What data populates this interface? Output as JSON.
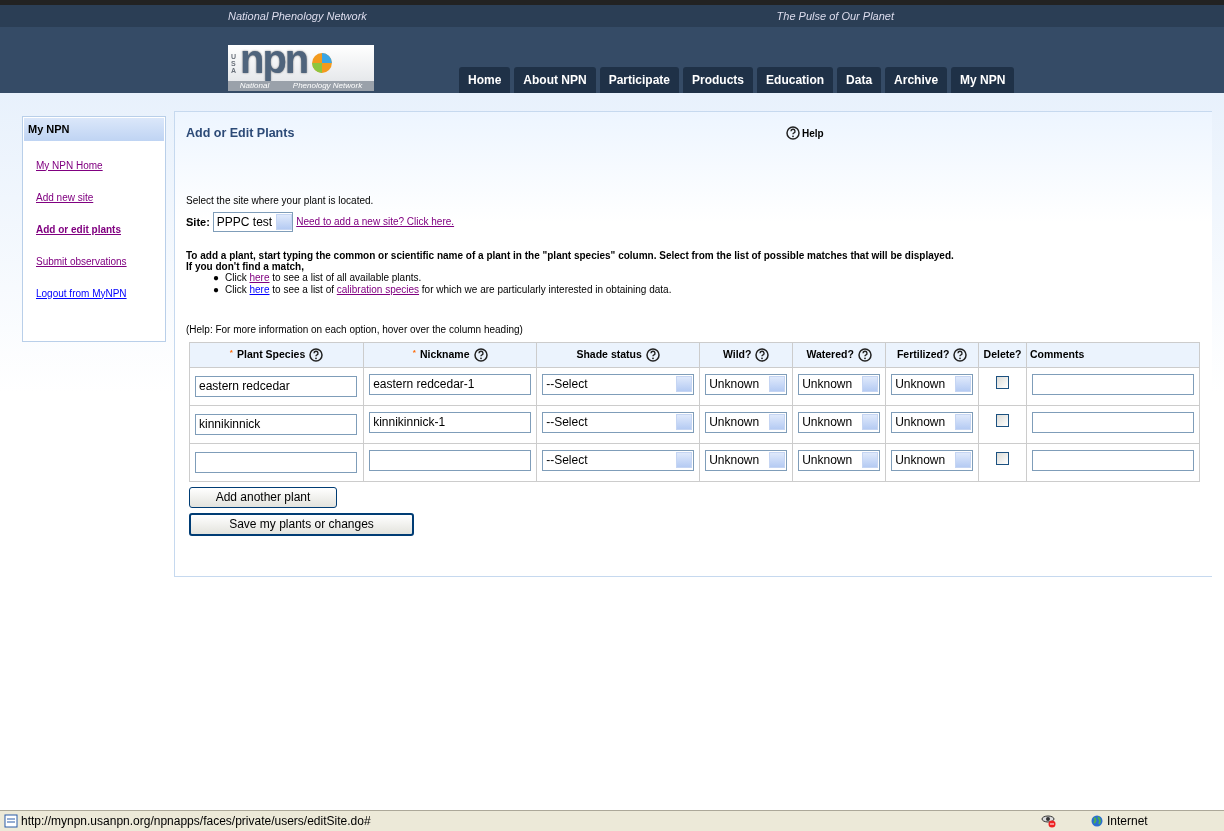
{
  "header": {
    "left_tagline": "National Phenology Network",
    "right_tagline": "The Pulse of Our Planet",
    "logo": {
      "country": "USA",
      "wordmark": "npn",
      "subtitle_1": "National",
      "subtitle_2": "Phenology Network"
    },
    "nav": [
      {
        "label": "Home"
      },
      {
        "label": "About NPN"
      },
      {
        "label": "Participate"
      },
      {
        "label": "Products"
      },
      {
        "label": "Education"
      },
      {
        "label": "Data"
      },
      {
        "label": "Archive"
      },
      {
        "label": "My NPN"
      }
    ]
  },
  "sidebar": {
    "title": "My NPN",
    "items": [
      {
        "label": "My NPN Home",
        "selected": false,
        "visited": true
      },
      {
        "label": "Add new site",
        "selected": false,
        "visited": true
      },
      {
        "label": "Add or edit plants",
        "selected": true,
        "visited": true
      },
      {
        "label": "Submit observations",
        "selected": false,
        "visited": true
      },
      {
        "label": "Logout from MyNPN",
        "selected": false,
        "visited": false
      }
    ]
  },
  "main": {
    "title": "Add or Edit Plants",
    "help": "Help",
    "site_prompt": "Select the site where your plant is located.",
    "site_label": "Site:",
    "site_value": "PPPC test",
    "site_link": "Need to add a new site? Click here.",
    "instructions": [
      "To add a plant, start typing the common or scientific name of a plant in the \"plant species\" column. Select from the list of possible matches that will be displayed.",
      "If you don't find a match,"
    ],
    "bullet_marker": "●",
    "bullets": [
      [
        {
          "kind": "text",
          "text": "Click "
        },
        {
          "kind": "link",
          "text": "here",
          "visited": true
        },
        {
          "kind": "text",
          "text": " to see a list of all available plants."
        }
      ],
      [
        {
          "kind": "text",
          "text": "Click "
        },
        {
          "kind": "link",
          "text": "here",
          "visited": false
        },
        {
          "kind": "text",
          "text": " to see a list of "
        },
        {
          "kind": "link",
          "text": "calibration species",
          "visited": true
        },
        {
          "kind": "text",
          "text": " for which we are particularly interested in obtaining data."
        }
      ]
    ],
    "table_help": "(Help: For more information on each option, hover over the column heading)",
    "table": {
      "columns": [
        {
          "label": "Plant Species",
          "required_marker": "*",
          "help": true
        },
        {
          "label": "Nickname",
          "required_marker": "*",
          "help": true
        },
        {
          "label": "Shade status",
          "help": true
        },
        {
          "label": "Wild?",
          "help": true
        },
        {
          "label": "Watered?",
          "help": true
        },
        {
          "label": "Fertilized?",
          "help": true
        },
        {
          "label": "Delete?"
        },
        {
          "label": "Comments"
        }
      ],
      "rows": [
        {
          "species": "eastern redcedar",
          "nickname": "eastern redcedar-1",
          "shade": "--Select",
          "wild": "Unknown",
          "watered": "Unknown",
          "fertilized": "Unknown",
          "delete": false
        },
        {
          "species": "kinnikinnick",
          "nickname": "kinnikinnick-1",
          "shade": "--Select",
          "wild": "Unknown",
          "watered": "Unknown",
          "fertilized": "Unknown",
          "delete": false
        },
        {
          "shade": "--Select",
          "wild": "Unknown",
          "watered": "Unknown",
          "fertilized": "Unknown",
          "delete": false
        }
      ]
    },
    "buttons": [
      {
        "label": "Add another plant",
        "kind": "plain"
      },
      {
        "label": "Save my plants or changes",
        "kind": "default"
      }
    ]
  },
  "status_bar": {
    "url": "http://mynpn.usanpn.org/npnapps/faces/private/users/editSite.do#",
    "zone": "Internet"
  }
}
